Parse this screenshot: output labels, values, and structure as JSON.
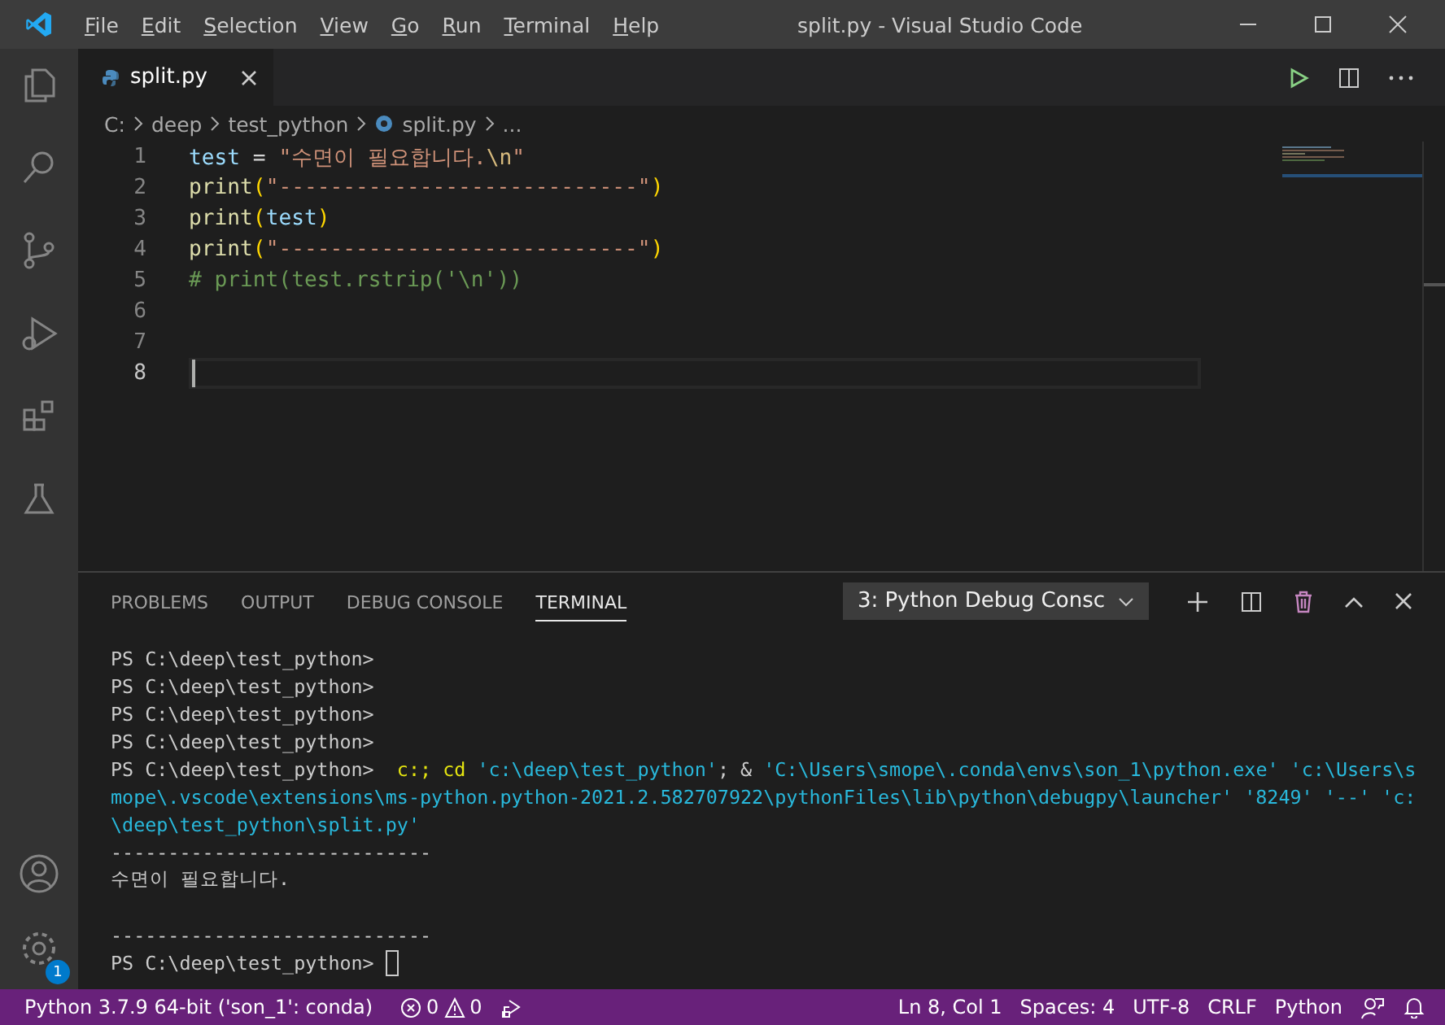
{
  "window": {
    "title": "split.py - Visual Studio Code"
  },
  "menu": [
    {
      "label": "File"
    },
    {
      "label": "Edit"
    },
    {
      "label": "Selection"
    },
    {
      "label": "View"
    },
    {
      "label": "Go"
    },
    {
      "label": "Run"
    },
    {
      "label": "Terminal"
    },
    {
      "label": "Help"
    }
  ],
  "activity_bar": {
    "settings_badge": "1"
  },
  "tabs": [
    {
      "label": "split.py",
      "selected": true
    }
  ],
  "breadcrumb": [
    {
      "label": "C:",
      "kind": "folder"
    },
    {
      "label": "deep",
      "kind": "folder"
    },
    {
      "label": "test_python",
      "kind": "folder"
    },
    {
      "label": "split.py",
      "kind": "file"
    },
    {
      "label": "...",
      "kind": "more"
    }
  ],
  "editor": {
    "lines": [
      {
        "number": "1",
        "current": false,
        "tokens": [
          {
            "kind": "var",
            "text": "test"
          },
          {
            "kind": "op",
            "text": " = "
          },
          {
            "kind": "str",
            "text": "\"수면이 필요합니다."
          },
          {
            "kind": "esc",
            "text": "\\n"
          },
          {
            "kind": "str",
            "text": "\""
          }
        ]
      },
      {
        "number": "2",
        "current": false,
        "tokens": [
          {
            "kind": "fn",
            "text": "print"
          },
          {
            "kind": "punc",
            "text": "("
          },
          {
            "kind": "str",
            "text": "\"----------------------------\""
          },
          {
            "kind": "punc",
            "text": ")"
          }
        ]
      },
      {
        "number": "3",
        "current": false,
        "tokens": [
          {
            "kind": "fn",
            "text": "print"
          },
          {
            "kind": "punc",
            "text": "("
          },
          {
            "kind": "var",
            "text": "test"
          },
          {
            "kind": "punc",
            "text": ")"
          }
        ]
      },
      {
        "number": "4",
        "current": false,
        "tokens": [
          {
            "kind": "fn",
            "text": "print"
          },
          {
            "kind": "punc",
            "text": "("
          },
          {
            "kind": "str",
            "text": "\"----------------------------\""
          },
          {
            "kind": "punc",
            "text": ")"
          }
        ]
      },
      {
        "number": "5",
        "current": false,
        "tokens": [
          {
            "kind": "comment",
            "text": "# print(test.rstrip('\\n'))"
          }
        ]
      },
      {
        "number": "6",
        "current": false
      },
      {
        "number": "7",
        "current": false
      },
      {
        "number": "8",
        "current": true
      }
    ]
  },
  "panel": {
    "tabs": [
      {
        "label": "PROBLEMS",
        "selected": false
      },
      {
        "label": "OUTPUT",
        "selected": false
      },
      {
        "label": "DEBUG CONSOLE",
        "selected": false
      },
      {
        "label": "TERMINAL",
        "selected": true
      }
    ],
    "terminal_select": "3: Python Debug Consc",
    "terminal_lines": [
      {
        "segments": [
          {
            "kind": "plain",
            "text": "PS C:\\deep\\test_python>"
          }
        ]
      },
      {
        "segments": [
          {
            "kind": "plain",
            "text": "PS C:\\deep\\test_python>"
          }
        ]
      },
      {
        "segments": [
          {
            "kind": "plain",
            "text": "PS C:\\deep\\test_python>"
          }
        ]
      },
      {
        "segments": [
          {
            "kind": "plain",
            "text": "PS C:\\deep\\test_python>"
          }
        ]
      },
      {
        "segments": [
          {
            "kind": "plain",
            "text": "PS C:\\deep\\test_python>  "
          },
          {
            "kind": "cmd",
            "text": "c:; cd "
          },
          {
            "kind": "str",
            "text": "'c:\\deep\\test_python'"
          },
          {
            "kind": "plain",
            "text": "; & "
          },
          {
            "kind": "str",
            "text": "'C:\\Users\\smope\\.conda\\envs\\son_1\\python.exe' 'c:\\Users\\s"
          }
        ]
      },
      {
        "segments": [
          {
            "kind": "str",
            "text": "mope\\.vscode\\extensions\\ms-python.python-2021.2.582707922\\pythonFiles\\lib\\python\\debugpy\\launcher' '8249' '--' 'c:"
          }
        ]
      },
      {
        "segments": [
          {
            "kind": "str",
            "text": "\\deep\\test_python\\split.py'"
          }
        ]
      },
      {
        "segments": [
          {
            "kind": "plain",
            "text": "----------------------------"
          }
        ]
      },
      {
        "segments": [
          {
            "kind": "plain",
            "text": "수면이 필요합니다."
          }
        ]
      },
      {
        "space_before": true,
        "segments": [
          {
            "kind": "plain",
            "text": "----------------------------"
          }
        ]
      },
      {
        "segments": [
          {
            "kind": "plain",
            "text": "PS C:\\deep\\test_python> "
          }
        ],
        "cursor": true
      }
    ]
  },
  "status_bar": {
    "interpreter": "Python 3.7.9 64-bit ('son_1': conda)",
    "errors": "0",
    "warnings": "0",
    "position": "Ln 8, Col 1",
    "spaces": "Spaces: 4",
    "encoding": "UTF-8",
    "eol": "CRLF",
    "language": "Python"
  }
}
